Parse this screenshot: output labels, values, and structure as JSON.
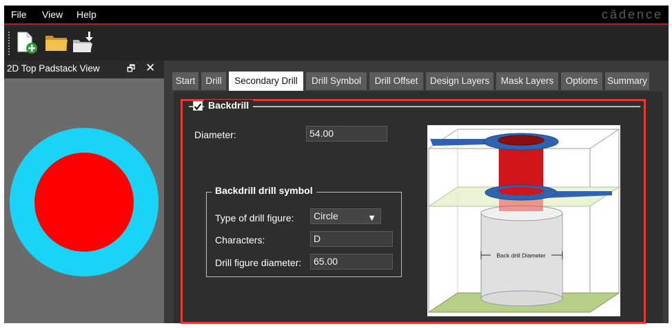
{
  "menu": {
    "items": [
      "File",
      "View",
      "Help"
    ],
    "brand": "cādence"
  },
  "toolbar": {
    "buttons": [
      "new-file-icon",
      "open-folder-icon",
      "import-folder-icon"
    ]
  },
  "left_panel": {
    "title": "2D Top Padstack View",
    "float_glyph": "🗗",
    "close_glyph": "✕",
    "colors": {
      "outer": "#1bd3f7",
      "inner": "#ff0000"
    }
  },
  "tabs": [
    {
      "label": "Start"
    },
    {
      "label": "Drill"
    },
    {
      "label": "Secondary Drill",
      "active": true
    },
    {
      "label": "Drill Symbol"
    },
    {
      "label": "Drill Offset"
    },
    {
      "label": "Design Layers"
    },
    {
      "label": "Mask Layers"
    },
    {
      "label": "Options"
    },
    {
      "label": "Summary"
    }
  ],
  "backdrill": {
    "checkbox_label": "Backdrill",
    "checked": true,
    "diameter_label": "Diameter:",
    "diameter_value": "54.00",
    "symbol_group": {
      "title": "Backdrill drill symbol",
      "type_label": "Type of drill figure:",
      "type_value": "Circle",
      "characters_label": "Characters:",
      "characters_value": "D",
      "figure_diameter_label": "Drill figure diameter:",
      "figure_diameter_value": "65.00"
    },
    "diagram_annotation": "Back drill Diameter"
  },
  "colors": {
    "accent": "#e53935",
    "menu_bg": "#000000",
    "panel_bg": "#3a3a3a"
  }
}
